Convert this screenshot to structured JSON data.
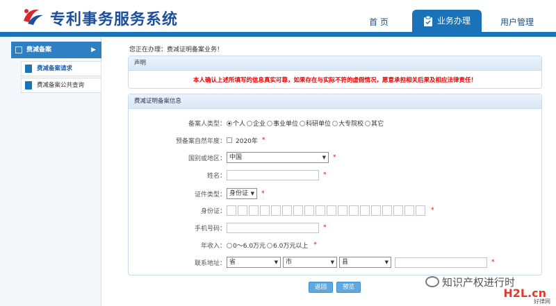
{
  "app": {
    "title": "专利事务服务系统"
  },
  "nav": {
    "home": "首  页",
    "business": "业务办理",
    "user": "用户管理"
  },
  "sidebar": {
    "section": "费减备案",
    "items": [
      {
        "label": "费减备案请求"
      },
      {
        "label": "费减备案公共查询"
      }
    ]
  },
  "breadcrumb": "您正在办理：费减证明备案业务！",
  "statement": {
    "title": "声明",
    "text": "本人确认上述所填写的信息真实可靠，如果存在与实际不符的虚假情况，愿意承担相关后果及相应法律责任！"
  },
  "form": {
    "title": "费减证明备案信息",
    "type_label": "备案人类型：",
    "type_options": [
      "个人",
      "企业",
      "事业单位",
      "科研单位",
      "大专院校",
      "其它"
    ],
    "type_selected": "个人",
    "year_label": "预备案自然年度：",
    "year_value": "2020年",
    "country_label": "国别或地区：",
    "country_value": "中国",
    "name_label": "姓名：",
    "idtype_label": "证件类型：",
    "idtype_value": "身份证",
    "idno_label": "身份证：",
    "phone_label": "手机号码：",
    "income_label": "年收入：",
    "income_options": [
      "0～6.0万元",
      "6.0万元以上"
    ],
    "address_label": "联系地址：",
    "province": "省",
    "city": "市",
    "county": "县",
    "required_mark": "*"
  },
  "buttons": {
    "back": "返回",
    "preview": "预览"
  },
  "watermark": {
    "text": "知识产权进行时",
    "brand": "H2L.cn",
    "brand_sub": "好律网"
  },
  "colors": {
    "primary": "#1a73b8",
    "title": "#1d4f9a",
    "warning": "#e00000"
  }
}
